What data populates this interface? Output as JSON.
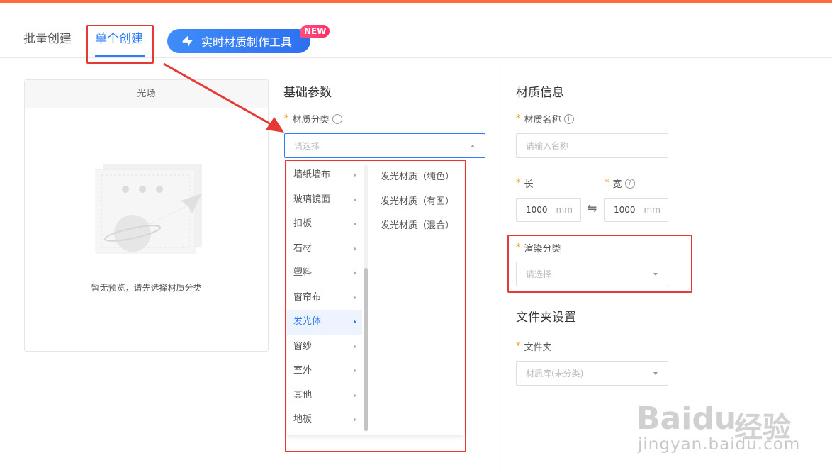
{
  "tabs": {
    "batch": "批量创建",
    "single": "单个创建",
    "tool_button": "实时材质制作工具",
    "new_badge": "NEW"
  },
  "preview": {
    "header": "光场",
    "empty_text": "暂无预览，请先选择材质分类"
  },
  "basic_params": {
    "title": "基础参数",
    "category_label": "材质分类",
    "category_placeholder": "请选择"
  },
  "cascader": {
    "level1": [
      "墙纸墙布",
      "玻璃镜面",
      "扣板",
      "石材",
      "塑料",
      "窗帘布",
      "发光体",
      "窗纱",
      "室外",
      "其他",
      "地板"
    ],
    "active_index": 6,
    "level2": [
      "发光材质（纯色）",
      "发光材质（有图）",
      "发光材质（混合）"
    ]
  },
  "material_info": {
    "title": "材质信息",
    "name_label": "材质名称",
    "name_placeholder": "请输入名称",
    "length_label": "长",
    "width_label": "宽",
    "length_value": "1000",
    "width_value": "1000",
    "unit": "mm",
    "swap_symbol": "⇋",
    "render_label": "渲染分类",
    "render_placeholder": "请选择"
  },
  "folder": {
    "title": "文件夹设置",
    "label": "文件夹",
    "value": "材质库(未分类)"
  },
  "watermark": {
    "logo": "Bai",
    "logo_suffix": "du",
    "cn": "经验",
    "url": "jingyan.baidu.com"
  },
  "colors": {
    "accent": "#2f7cf6",
    "top_bar": "#ff6a3d",
    "highlight": "#e53935",
    "required": "#f39c12"
  }
}
